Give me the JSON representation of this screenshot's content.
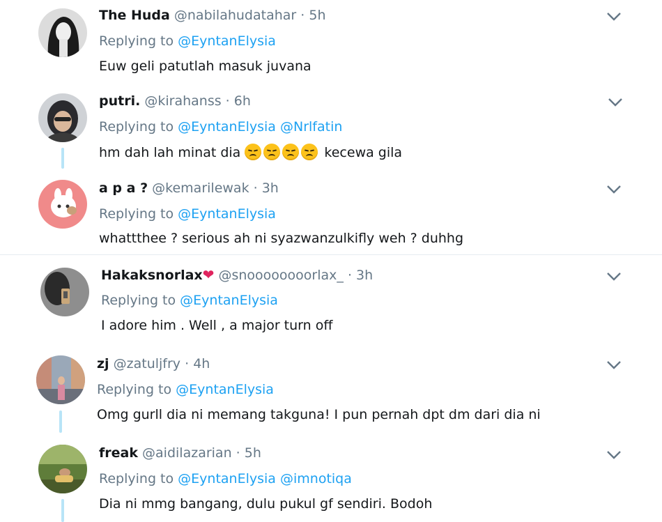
{
  "ui": {
    "replying_prefix": "Replying to",
    "separator": "·"
  },
  "tweets": [
    {
      "name": "The Huda",
      "handle": "@nabilahudatahar",
      "time": "5h",
      "mentions": [
        "@EyntanElysia"
      ],
      "text": "Euw geli patutlah masuk juvana"
    },
    {
      "name": "putri.",
      "handle": "@kirahanss",
      "time": "6h",
      "mentions": [
        "@EyntanElysia",
        "@Nrlfatin"
      ],
      "text_before": "hm dah lah minat dia",
      "text_after": "kecewa gila",
      "emoji": [
        "disappointed-face",
        "disappointed-face",
        "disappointed-face",
        "disappointed-face"
      ]
    },
    {
      "name": "a p a ?",
      "handle": "@kemarilewak",
      "time": "3h",
      "mentions": [
        "@EyntanElysia"
      ],
      "text": "whattthee ? serious ah ni syazwanzulkifly weh ? duhhg"
    },
    {
      "name": "Hakaksnorlax",
      "name_emoji": "❤",
      "handle": "@snoooooooorlax_",
      "time": "3h",
      "mentions": [
        "@EyntanElysia"
      ],
      "text": "I adore him . Well , a major turn off"
    },
    {
      "name": "zj",
      "handle": "@zatuljfry",
      "time": "4h",
      "mentions": [
        "@EyntanElysia"
      ],
      "text": "Omg gurll dia ni memang takguna! I pun pernah dpt dm dari dia ni"
    },
    {
      "name": "freak",
      "handle": "@aidilazarian",
      "time": "5h",
      "mentions": [
        "@EyntanElysia",
        "@imnotiqa"
      ],
      "text": "Dia ni mmg bangang, dulu pukul gf sendiri. Bodoh"
    }
  ],
  "colors": {
    "mention": "#1da1f2",
    "secondary": "#657786",
    "thread_line": "#b8e4f7",
    "heart": "#e0245e"
  }
}
